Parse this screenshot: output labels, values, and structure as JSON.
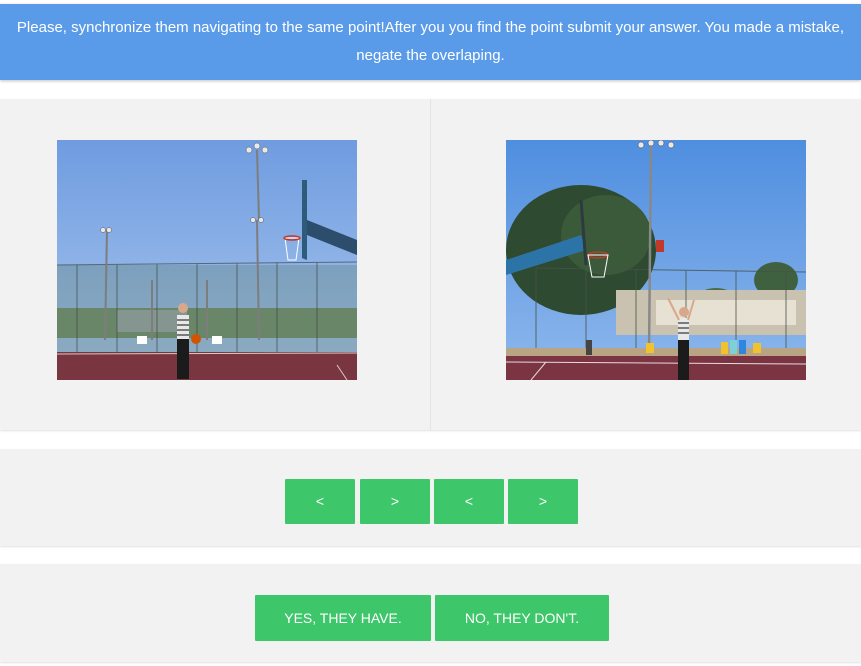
{
  "instruction": {
    "line1": "Please, synchronize them navigating to the same point!After you you find the point submit your answer. You made a mistake,",
    "line2": "negate the overlaping."
  },
  "videos": {
    "left_frame": "basketball-court-frame",
    "right_frame": "basketball-court-frame"
  },
  "navigation": {
    "left_back": "<",
    "left_forward": ">",
    "right_back": "<",
    "right_forward": ">"
  },
  "answer": {
    "yes_label": "YES, THEY HAVE.",
    "no_label": "NO, THEY DON'T."
  },
  "colors": {
    "banner": "#5a9be9",
    "button": "#3ec66a",
    "panel": "#f2f2f2"
  }
}
